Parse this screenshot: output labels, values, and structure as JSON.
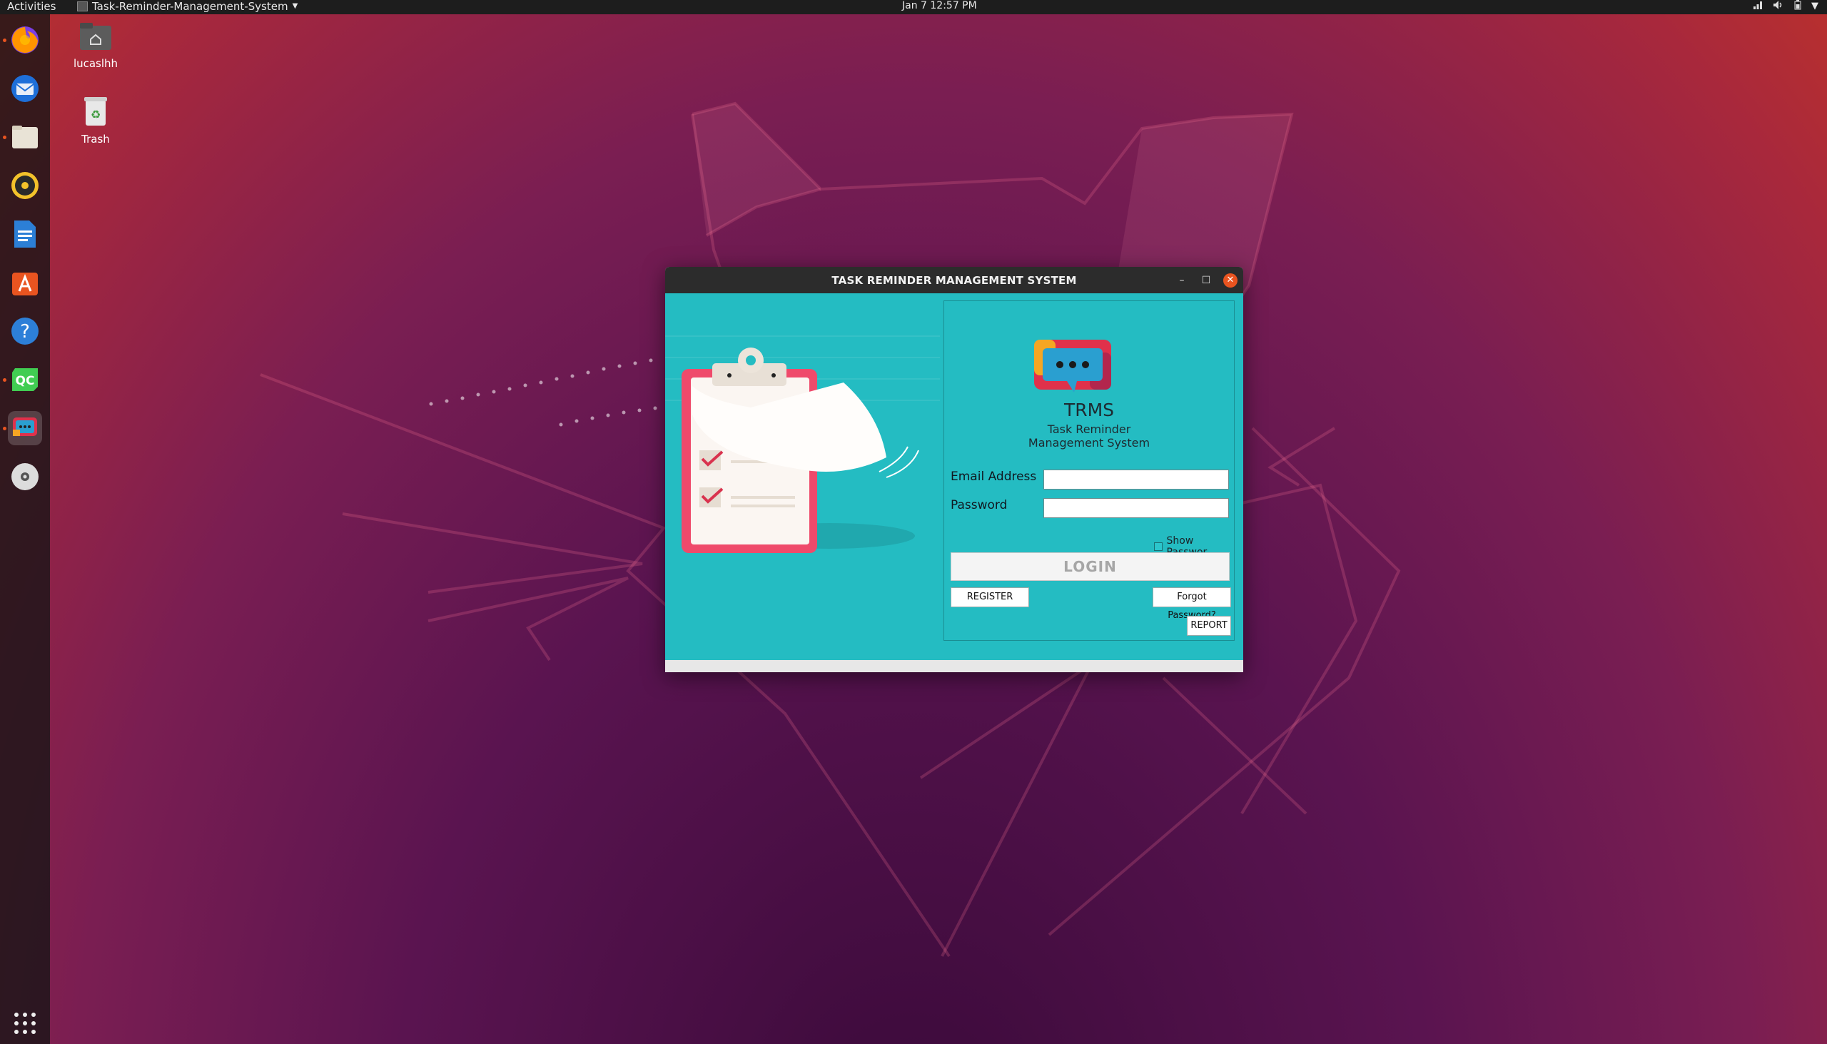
{
  "topbar": {
    "activities": "Activities",
    "app_menu": "Task-Reminder-Management-System",
    "clock": "Jan 7  12:57 PM"
  },
  "dock": {
    "items": [
      "firefox",
      "thunderbird",
      "files",
      "rhythmbox",
      "libreoffice-writer",
      "ubuntu-software",
      "help",
      "qt-creator",
      "trms-app",
      "dvd-drive"
    ],
    "show_apps": "show-applications"
  },
  "desktop": {
    "icons": [
      {
        "label": "lucaslhh",
        "icon": "home-folder-icon"
      },
      {
        "label": "Trash",
        "icon": "trash-icon"
      }
    ]
  },
  "window": {
    "title": "TASK REMINDER MANAGEMENT SYSTEM",
    "colors": {
      "panel": "#24bcc2",
      "logo_red": "#e0314b",
      "logo_orange": "#f5a623",
      "clipboard": "#ef4a6b"
    },
    "brand": {
      "name": "TRMS",
      "sub1": "Task Reminder",
      "sub2": "Management System"
    },
    "form": {
      "email_label": "Email Address",
      "email_value": "",
      "password_label": "Password",
      "password_value": "",
      "show_password": "Show Passwor",
      "show_password_checked": false
    },
    "buttons": {
      "login": "LOGIN",
      "register": "REGISTER",
      "forgot": "Forgot Password?",
      "report": "REPORT"
    }
  }
}
